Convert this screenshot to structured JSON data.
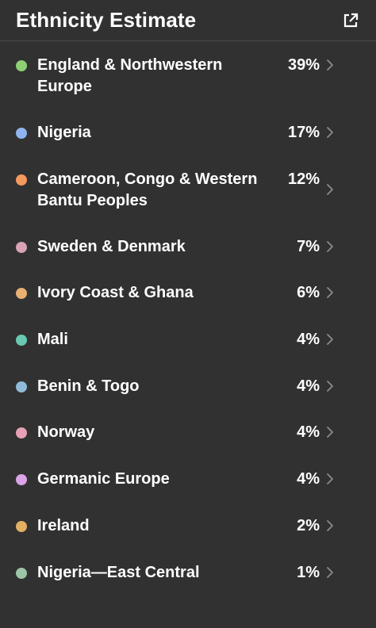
{
  "header": {
    "title": "Ethnicity Estimate",
    "external_link_icon": "external-link-icon"
  },
  "regions": [
    {
      "name": "England & Northwestern Europe",
      "percent": "39%",
      "color": "#8fcf74"
    },
    {
      "name": "Nigeria",
      "percent": "17%",
      "color": "#8fb4f0"
    },
    {
      "name": "Cameroon, Congo & Western Bantu Peoples",
      "percent": "12%",
      "color": "#f39a5d"
    },
    {
      "name": "Sweden & Denmark",
      "percent": "7%",
      "color": "#d9a3b3"
    },
    {
      "name": "Ivory Coast & Ghana",
      "percent": "6%",
      "color": "#e8b071"
    },
    {
      "name": "Mali",
      "percent": "4%",
      "color": "#69c9b0"
    },
    {
      "name": "Benin & Togo",
      "percent": "4%",
      "color": "#8fbbd8"
    },
    {
      "name": "Norway",
      "percent": "4%",
      "color": "#e7a1b5"
    },
    {
      "name": "Germanic Europe",
      "percent": "4%",
      "color": "#d9a3e6"
    },
    {
      "name": "Ireland",
      "percent": "2%",
      "color": "#e2b063"
    },
    {
      "name": "Nigeria—East Central",
      "percent": "1%",
      "color": "#9cc4a6"
    }
  ],
  "row_chevron_icon": "chevron-right-icon"
}
